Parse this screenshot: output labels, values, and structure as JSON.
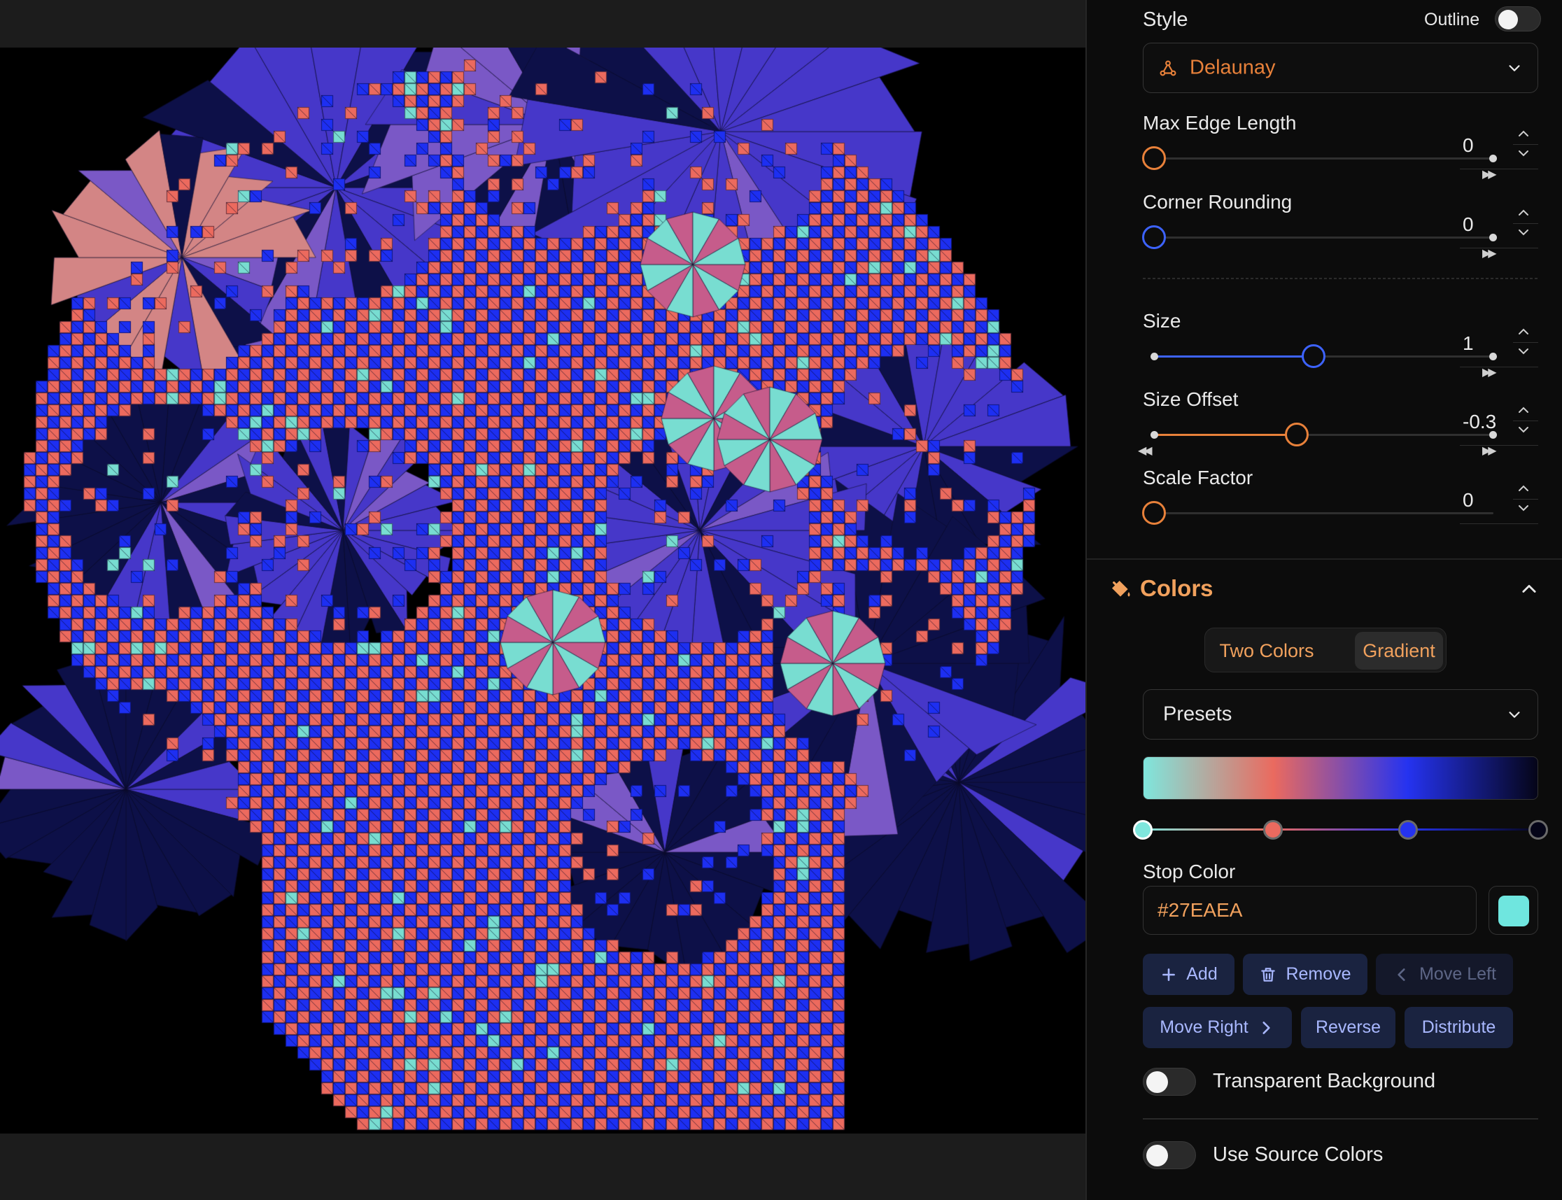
{
  "style": {
    "label": "Style",
    "outline_label": "Outline",
    "outline_on": false,
    "select_value": "Delaunay",
    "icon": "triangle-nodes-icon"
  },
  "sliders": [
    {
      "id": "max-edge-length",
      "label": "Max Edge Length",
      "value": "0",
      "fraction": 0.0,
      "accent": "#e8813a",
      "fast_forward": true,
      "rewind": false
    },
    {
      "id": "corner-rounding",
      "label": "Corner Rounding",
      "value": "0",
      "fraction": 0.0,
      "accent": "#3d63ff",
      "fast_forward": true,
      "rewind": false
    },
    {
      "id": "size",
      "label": "Size",
      "value": "1",
      "fraction": 0.47,
      "accent": "#3d63ff",
      "fast_forward": true,
      "rewind": false
    },
    {
      "id": "size-offset",
      "label": "Size Offset",
      "value": "-0.3",
      "fraction": 0.42,
      "accent": "#e8813a",
      "fast_forward": true,
      "rewind": true
    },
    {
      "id": "scale-factor",
      "label": "Scale Factor",
      "value": "0",
      "fraction": 0.0,
      "accent": "#e8813a",
      "fast_forward": false,
      "rewind": false
    }
  ],
  "colors": {
    "title": "Colors",
    "icon": "paint-bucket-icon",
    "tabs": [
      "Two Colors",
      "Gradient"
    ],
    "active_tab": "Gradient",
    "presets_label": "Presets",
    "gradient_stops": [
      "#7fe6dd",
      "#ea6a5f",
      "#2533f0",
      "#050518"
    ],
    "stop_color_label": "Stop Color",
    "stop_color_value": "#27EAEA",
    "swatch_color": "#6fe6df",
    "buttons": {
      "add": "Add",
      "remove": "Remove",
      "move_left": "Move Left",
      "move_right": "Move Right",
      "reverse": "Reverse",
      "distribute": "Distribute"
    },
    "transparent_background_label": "Transparent Background",
    "transparent_background_on": false,
    "use_source_colors_label": "Use Source Colors",
    "use_source_colors_on": false
  },
  "palette": {
    "red": "#ec6a5e",
    "blue": "#1d2ff2",
    "cyan": "#78ddd1",
    "navy": "#0d1048",
    "violet": "#4637c9",
    "lavender": "#7a58c6",
    "salmon": "#d38585",
    "background": "#000000"
  }
}
